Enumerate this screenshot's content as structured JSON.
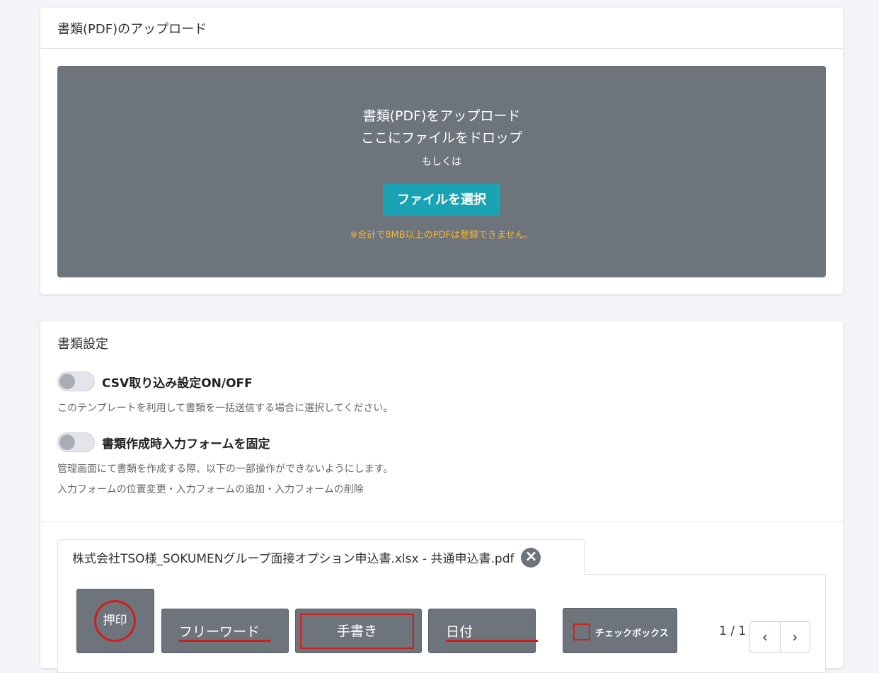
{
  "upload": {
    "header": "書類(PDF)のアップロード",
    "title": "書類(PDF)をアップロード",
    "drop_text": "ここにファイルをドロップ",
    "or_text": "もしくは",
    "select_button": "ファイルを選択",
    "note": "※合計で8MB以上のPDFは登録できません。",
    "note_color": "#f5b730",
    "button_color": "#1aa3b5"
  },
  "settings": {
    "title": "書類設定",
    "csv": {
      "label": "CSV取り込み設定ON/OFF",
      "enabled": false,
      "description": "このテンプレートを利用して書類を一括送信する場合に選択してください。"
    },
    "fixed_form": {
      "label": "書類作成時入力フォームを固定",
      "enabled": false,
      "description1": "管理画面にて書類を作成する際、以下の一部操作ができないようにします。",
      "description2": "入力フォームの位置変更・入力フォームの追加・入力フォームの削除"
    }
  },
  "document": {
    "file_name": "株式会社TSO様_SOKUMENグループ面接オプション申込書.xlsx - 共通申込書.pdf",
    "close_icon": "×"
  },
  "tools": {
    "stamp": "押印",
    "freeword": "フリーワード",
    "handwrite": "手書き",
    "date": "日付",
    "checkbox": "チェックボックス"
  },
  "pager": {
    "text": "1 / 1",
    "prev": "‹",
    "next": "›"
  },
  "colors": {
    "tool_bg": "#6e747c",
    "accent_red": "#d01e1e"
  }
}
